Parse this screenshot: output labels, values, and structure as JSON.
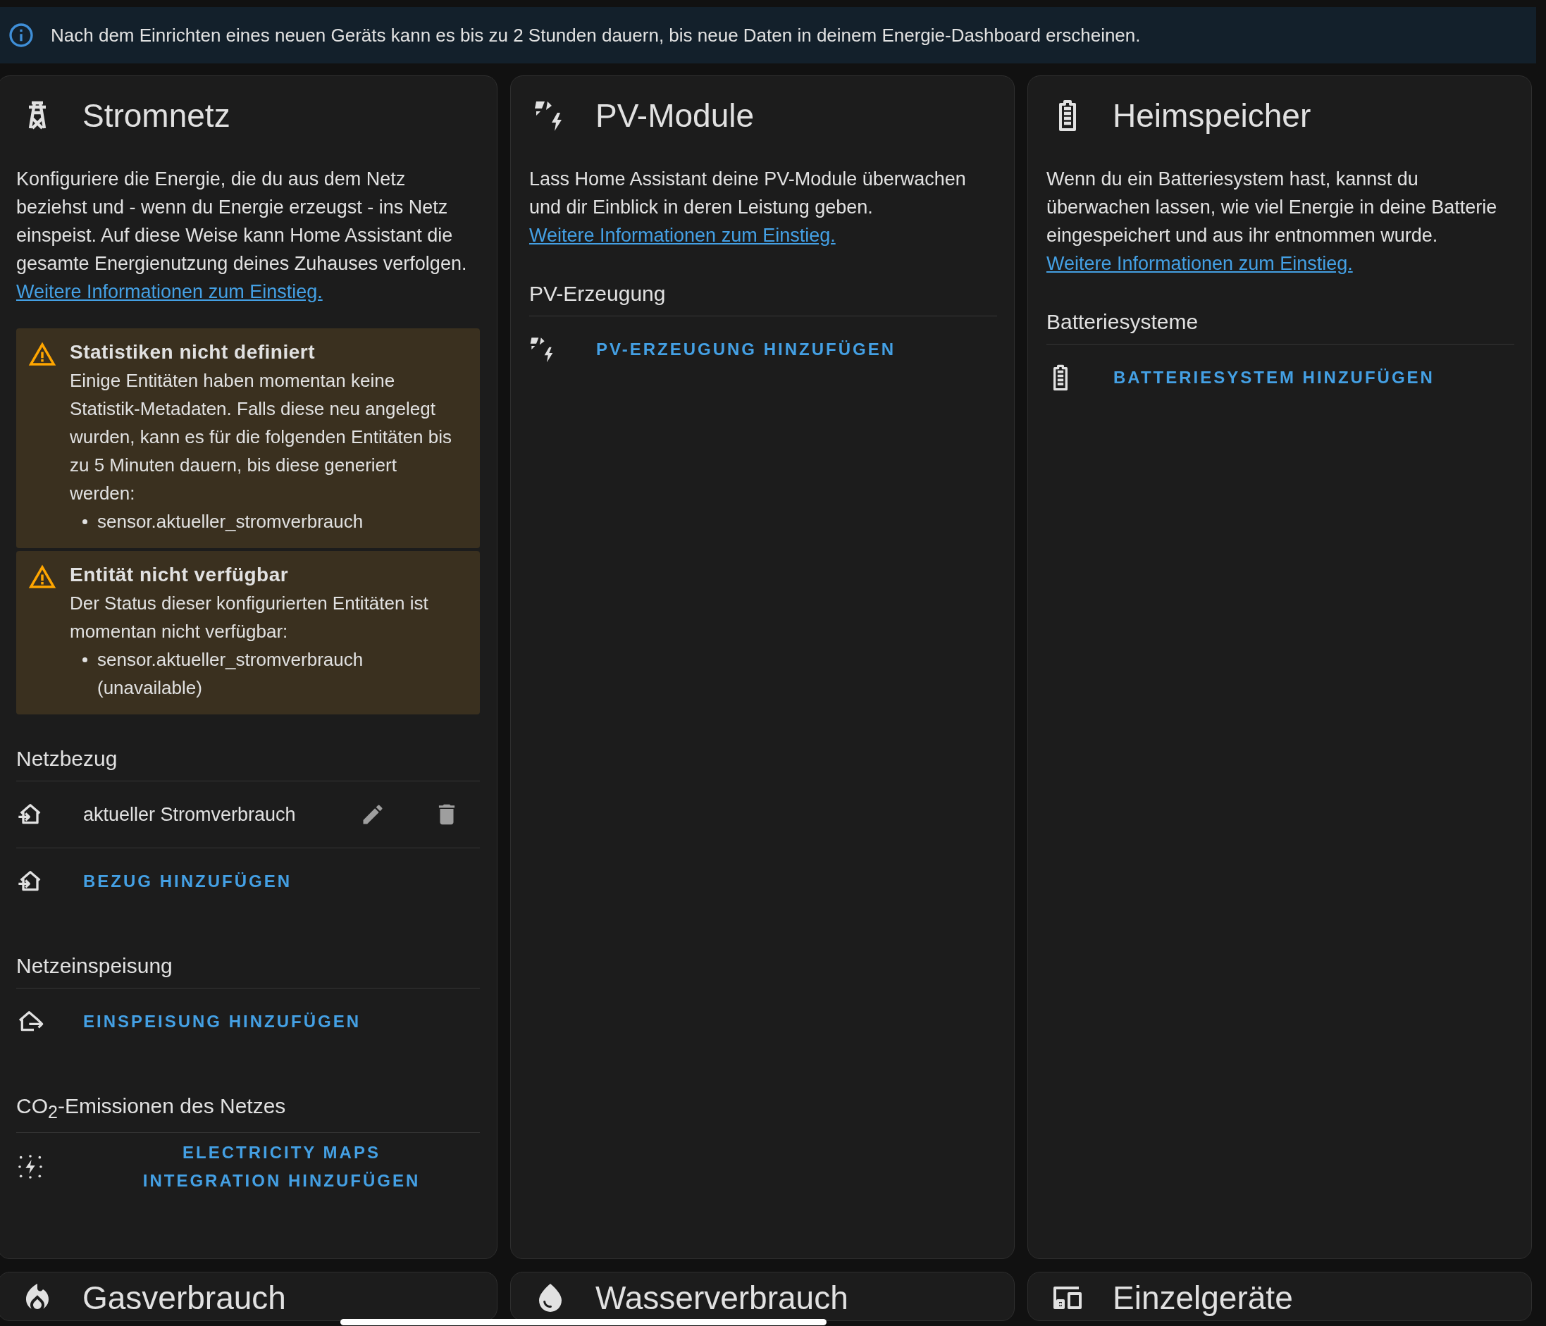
{
  "banner": {
    "text": "Nach dem Einrichten eines neuen Geräts kann es bis zu 2 Stunden dauern, bis neue Daten in deinem Energie-Dashboard erscheinen."
  },
  "cards": [
    {
      "title": "Stromnetz",
      "description": "Konfiguriere die Energie, die du aus dem Netz beziehst und - wenn du Energie erzeugst - ins Netz einspeist. Auf diese Weise kann Home Assistant die gesamte Energienutzung deines Zuhauses verfolgen.",
      "link": "Weitere Informationen zum Einstieg.",
      "alerts": [
        {
          "title": "Statistiken nicht definiert",
          "text": "Einige Entitäten haben momentan keine Statistik-Metadaten. Falls diese neu angelegt wurden, kann es für die folgenden Entitäten bis zu 5 Minuten dauern, bis diese generiert werden:",
          "items": [
            "sensor.aktueller_stromverbrauch"
          ]
        },
        {
          "title": "Entität nicht verfügbar",
          "text": "Der Status dieser konfigurierten Entitäten ist momentan nicht verfügbar:",
          "items": [
            "sensor.aktueller_stromverbrauch (unavailable)"
          ]
        }
      ],
      "sections": [
        {
          "heading": "Netzbezug",
          "rows": [
            {
              "kind": "entity",
              "label": "aktueller Stromverbrauch"
            },
            {
              "kind": "add",
              "label": "BEZUG HINZUFÜGEN"
            }
          ]
        },
        {
          "heading": "Netzeinspeisung",
          "rows": [
            {
              "kind": "add",
              "label": "EINSPEISUNG HINZUFÜGEN"
            }
          ]
        },
        {
          "heading": "CO$_{2}$-Emissionen des Netzes",
          "rows": [
            {
              "kind": "add-centered",
              "label": "ELECTRICITY MAPS INTEGRATION HINZUFÜGEN"
            }
          ]
        }
      ]
    },
    {
      "title": "PV-Module",
      "description": "Lass Home Assistant deine PV-Module überwachen und dir Einblick in deren Leistung geben.",
      "link": "Weitere Informationen zum Einstieg.",
      "sections": [
        {
          "heading": "PV-Erzeugung",
          "rows": [
            {
              "kind": "add",
              "label": "PV-ERZEUGUNG HINZUFÜGEN"
            }
          ]
        }
      ]
    },
    {
      "title": "Heimspeicher",
      "description": "Wenn du ein Batteriesystem hast, kannst du überwachen lassen, wie viel Energie in deine Batterie eingespeichert und aus ihr entnommen wurde.",
      "link": "Weitere Informationen zum Einstieg.",
      "sections": [
        {
          "heading": "Batteriesysteme",
          "rows": [
            {
              "kind": "add",
              "label": "BATTERIESYSTEM HINZUFÜGEN"
            }
          ]
        }
      ]
    }
  ],
  "bottom_cards": [
    {
      "title": "Gasverbrauch"
    },
    {
      "title": "Wasserverbrauch"
    },
    {
      "title": "Einzelgeräte"
    }
  ]
}
